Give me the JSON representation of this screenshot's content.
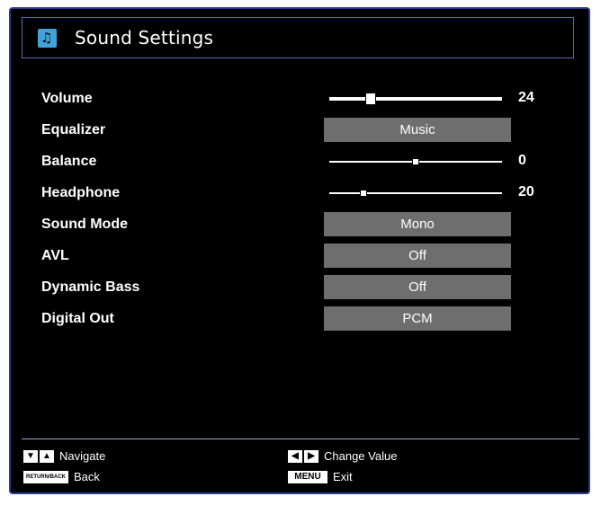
{
  "menu": {
    "title": "Sound Settings",
    "icon": "music-note-icon"
  },
  "settings": [
    {
      "label": "Volume",
      "type": "slider",
      "value": "24",
      "level": 0.24
    },
    {
      "label": "Equalizer",
      "type": "option",
      "value": "Music"
    },
    {
      "label": "Balance",
      "type": "slider",
      "value": "0",
      "level": 0.5
    },
    {
      "label": "Headphone",
      "type": "slider",
      "value": "20",
      "level": 0.2
    },
    {
      "label": "Sound Mode",
      "type": "option",
      "value": "Mono"
    },
    {
      "label": "AVL",
      "type": "option",
      "value": "Off"
    },
    {
      "label": "Dynamic Bass",
      "type": "option",
      "value": "Off"
    },
    {
      "label": "Digital Out",
      "type": "option",
      "value": "PCM"
    }
  ],
  "help": {
    "navigate": "Navigate",
    "back_key": "RETURN/BACK",
    "back": "Back",
    "change_value": "Change Value",
    "menu_key": "MENU",
    "exit": "Exit"
  },
  "colors": {
    "background": "#000000",
    "frame_border": "#2a3a8f",
    "value_box": "#6e6e6e",
    "icon": "#3fa3d9"
  }
}
